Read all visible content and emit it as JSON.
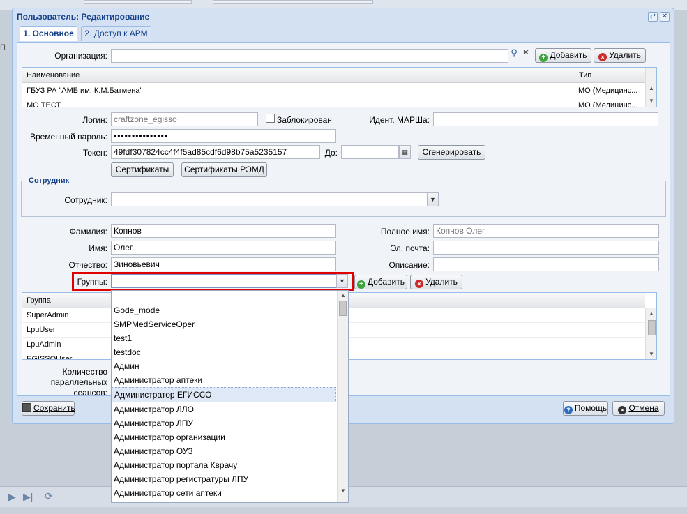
{
  "window": {
    "title": "Пользователь: Редактирование"
  },
  "tabs": [
    {
      "label": "1. Основное"
    },
    {
      "label": "2. Доступ к АРМ"
    }
  ],
  "background": {
    "left_fragment": "П"
  },
  "org": {
    "label": "Организация:",
    "value": "",
    "add_label": "Добавить",
    "delete_label": "Удалить",
    "columns": [
      "Наименование",
      "Тип"
    ],
    "rows": [
      {
        "name": "ГБУЗ РА \"АМБ им. К.М.Батмена\"",
        "type": "МО (Медицинс..."
      },
      {
        "name": "МО ТЕСТ",
        "type": "МО (Медицинс..."
      }
    ]
  },
  "login": {
    "login_label": "Логин:",
    "login_value": "craftzone_egisso",
    "blocked_label": "Заблокирован",
    "marsh_label": "Идент. МАРШа:",
    "marsh_value": "",
    "temp_pass_label": "Временный пароль:",
    "temp_pass_value": "•••••••••••••••",
    "token_label": "Токен:",
    "token_value": "49fdf307824cc4f4f5ad85cdf6d98b75a5235157",
    "until_label": "До:",
    "until_value": "",
    "generate_label": "Сгенерировать",
    "certs_label": "Сертификаты",
    "certs_remd_label": "Сертификаты РЭМД"
  },
  "employee": {
    "legend": "Сотрудник",
    "label": "Сотрудник:",
    "value": ""
  },
  "person": {
    "lastname_label": "Фамилия:",
    "lastname_value": "Копнов",
    "firstname_label": "Имя:",
    "firstname_value": "Олег",
    "middlename_label": "Отчество:",
    "middlename_value": "Зиновьевич",
    "fullname_label": "Полное имя:",
    "fullname_value": "Копнов Олег",
    "email_label": "Эл. почта:",
    "email_value": "",
    "description_label": "Описание:",
    "description_value": ""
  },
  "groups": {
    "label": "Группы:",
    "value": "",
    "add_label": "Добавить",
    "delete_label": "Удалить",
    "column": "Группа",
    "rows": [
      "SuperAdmin",
      "LpuUser",
      "LpuAdmin",
      "EGISSOUser"
    ],
    "dropdown": [
      "Gode_mode",
      "SMPMedServiceOper",
      "test1",
      "testdoc",
      "Админ",
      "Администратор аптеки",
      "Администратор ЕГИССО",
      "Администратор ЛЛО",
      "Администратор ЛПУ",
      "Администратор организации",
      "Администратор ОУЗ",
      "Администратор портала Кврачу",
      "Администратор регистратуры ЛПУ",
      "Администратор сети аптеки"
    ],
    "dropdown_selected_index": 6
  },
  "sessions": {
    "label_line1": "Количество",
    "label_line2": "параллельных",
    "label_line3": "сеансов:"
  },
  "footer": {
    "save_label": "Сохранить",
    "help_label": "Помощь",
    "cancel_label": "Отмена"
  }
}
